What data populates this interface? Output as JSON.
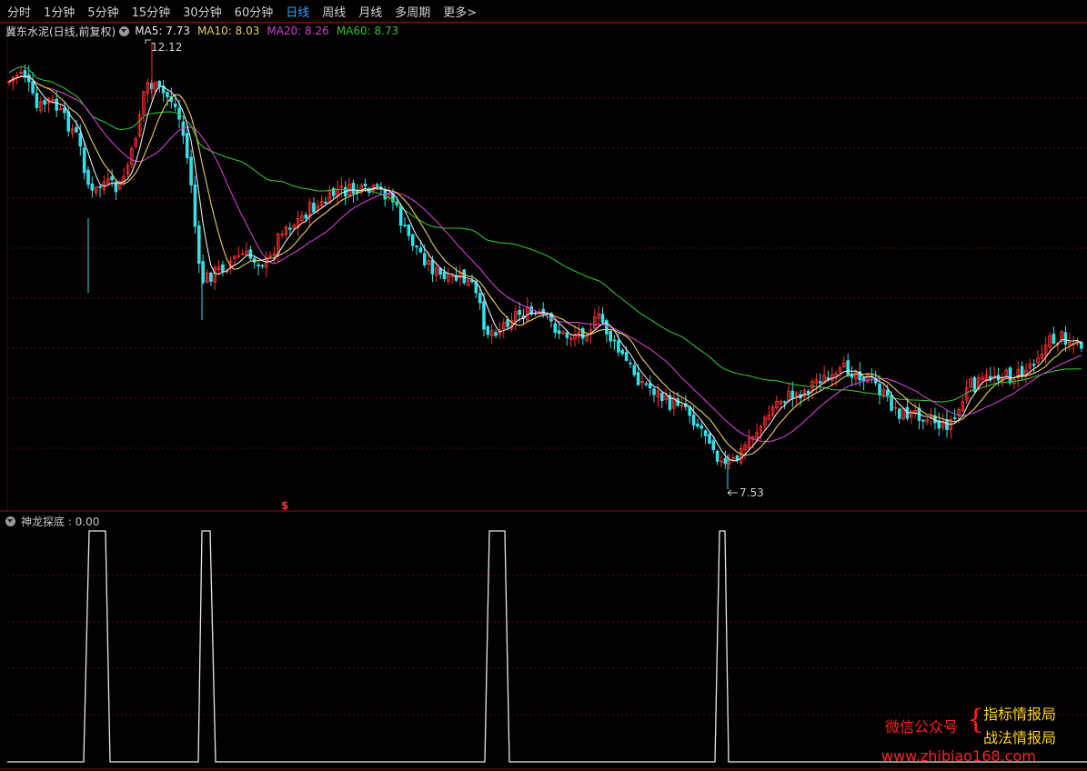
{
  "toolbar": {
    "tabs": [
      "分时",
      "1分钟",
      "5分钟",
      "15分钟",
      "30分钟",
      "60分钟",
      "日线",
      "周线",
      "月线",
      "多周期",
      "更多"
    ],
    "active_tab": "日线",
    "more_chevron": ">"
  },
  "main_chart": {
    "stock_name": "冀东水泥(日线,前复权)",
    "ma_labels": [
      {
        "text": "MA5: 7.73",
        "color": "#e8e8e8"
      },
      {
        "text": "MA10: 8.03",
        "color": "#e8d060"
      },
      {
        "text": "MA20: 8.26",
        "color": "#d040d0"
      },
      {
        "text": "MA60: 8.73",
        "color": "#30c030"
      }
    ],
    "high_label": "12.12",
    "low_label": "7.53",
    "marker": "$",
    "colors": {
      "up": "#ff3030",
      "down": "#36e0e8",
      "ma5": "#e8e8e8",
      "ma10": "#e8d060",
      "ma20": "#d040d0",
      "ma60": "#30c030",
      "grid": "#5a1010"
    }
  },
  "sub_chart": {
    "indicator_label": "神龙探底 : 0.00",
    "signal_line_color": "#e8e8e8"
  },
  "watermark": {
    "left": "微信公众号",
    "right1": "指标情报局",
    "right2": "战法情报局",
    "url": "www.zhibiao168.com",
    "brace": "{"
  },
  "icons": {
    "dropdown": "chevron-down-icon",
    "more": "chevron-right-icon"
  }
}
